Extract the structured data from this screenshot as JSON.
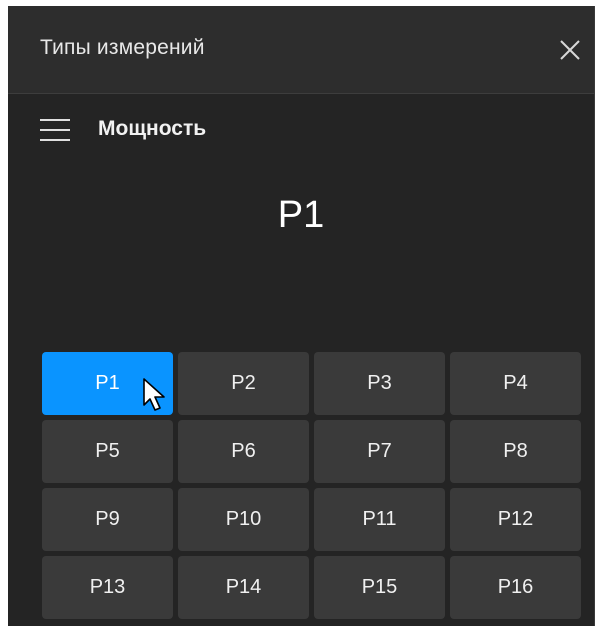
{
  "window": {
    "title": "Типы измерений",
    "close_icon": "close-icon"
  },
  "section": {
    "menu_icon": "hamburger-menu-icon",
    "title": "Мощность"
  },
  "selected_value": "P1",
  "buttons": [
    {
      "label": "P1",
      "active": true
    },
    {
      "label": "P2",
      "active": false
    },
    {
      "label": "P3",
      "active": false
    },
    {
      "label": "P4",
      "active": false
    },
    {
      "label": "P5",
      "active": false
    },
    {
      "label": "P6",
      "active": false
    },
    {
      "label": "P7",
      "active": false
    },
    {
      "label": "P8",
      "active": false
    },
    {
      "label": "P9",
      "active": false
    },
    {
      "label": "P10",
      "active": false
    },
    {
      "label": "P11",
      "active": false
    },
    {
      "label": "P12",
      "active": false
    },
    {
      "label": "P13",
      "active": false
    },
    {
      "label": "P14",
      "active": false
    },
    {
      "label": "P15",
      "active": false
    },
    {
      "label": "P16",
      "active": false
    }
  ],
  "colors": {
    "active_accent": "#0a94ff",
    "panel_background": "#242424",
    "button_background": "#3a3a3a"
  }
}
